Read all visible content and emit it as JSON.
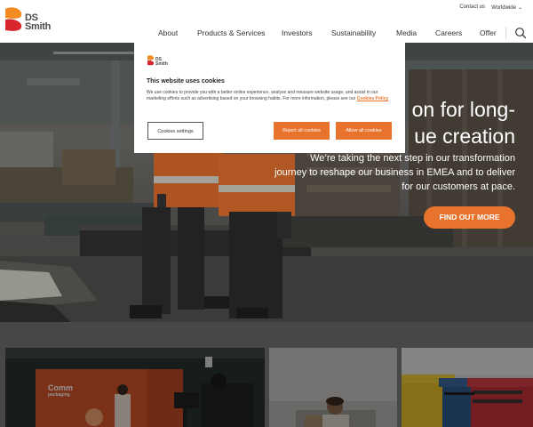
{
  "brand": {
    "logo_line1": "DS",
    "logo_line2": "Smith",
    "accent": "#e7732c",
    "logo_red": "#d8262e",
    "logo_orange": "#f28b20"
  },
  "header": {
    "contact": "Contact us",
    "worldwide": "Worldwide",
    "nav": [
      {
        "label": "About"
      },
      {
        "label": "Products & Services"
      },
      {
        "label": "Investors"
      },
      {
        "label": "Sustainability"
      },
      {
        "label": "Media"
      },
      {
        "label": "Careers"
      },
      {
        "label": "Offer"
      }
    ],
    "search_icon": "search-icon"
  },
  "hero": {
    "headline_line1": "on for long-",
    "headline_line2": "ue creation",
    "sub_line1": "We’re taking the next step in our transformation",
    "sub_line2": "journey to reshape our business in EMEA and to deliver",
    "sub_line3": "for our customers at pace.",
    "cta": "FIND OUT MORE"
  },
  "cookie_modal": {
    "title": "This website uses cookies",
    "body": "We use cookies to provide you with a better online experience, analyse and measure website usage, and assist in our marketing efforts such as advertising based on your browsing habits. For more information, please see our",
    "policy_link": "Cookies Policy",
    "settings_button": "Cookies settings",
    "reject_button": "Reject all cookies",
    "allow_button": "Allow all cookies"
  },
  "cards": [
    {
      "name": "studio-card",
      "screen_text_line1": "Comm",
      "screen_text_line2": "packaging"
    },
    {
      "name": "person-card"
    },
    {
      "name": "recycling-bins-card"
    }
  ]
}
